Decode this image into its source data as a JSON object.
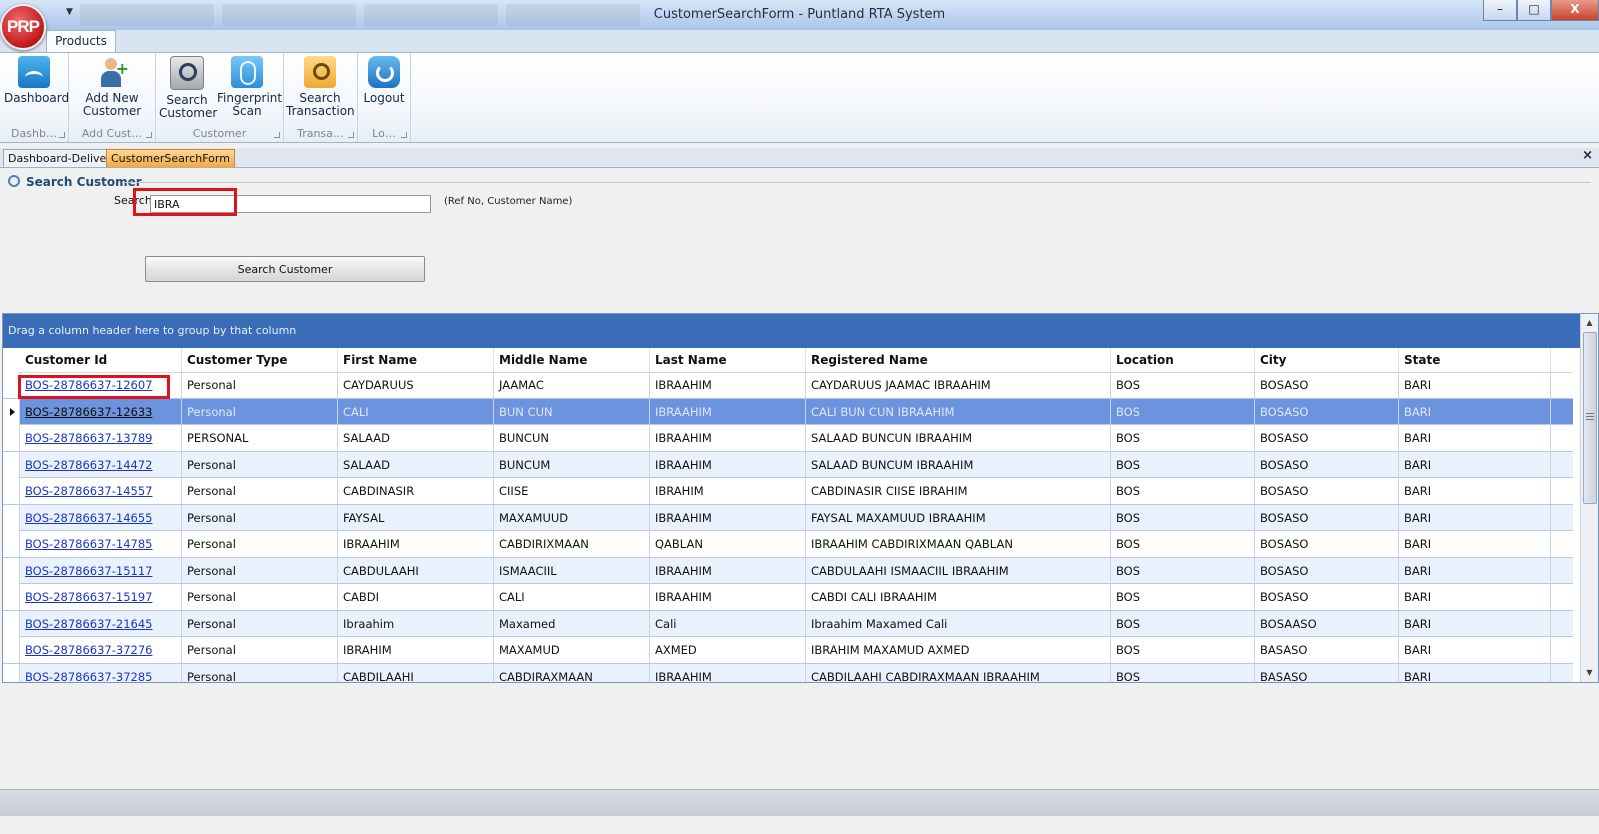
{
  "window": {
    "title": "CustomerSearchForm - Puntland RTA System",
    "logo": "PRP",
    "controls": {
      "minimize": "–",
      "maximize": "□",
      "close": "X"
    }
  },
  "ribbon": {
    "tab": "Products",
    "groups": [
      {
        "label": "Dashb…",
        "buttons": [
          {
            "label": "Dashboard",
            "icon": "dashboard-icon"
          }
        ]
      },
      {
        "label": "Add Cust…",
        "buttons": [
          {
            "label": "Add New Customer",
            "icon": "add-user-icon"
          }
        ]
      },
      {
        "label": "Customer",
        "buttons": [
          {
            "label": "Search Customer",
            "icon": "search-customer-icon"
          },
          {
            "label": "Fingerprint Scan",
            "icon": "fingerprint-icon"
          }
        ]
      },
      {
        "label": "Transa…",
        "buttons": [
          {
            "label": "Search Transaction",
            "icon": "search-transaction-icon"
          }
        ]
      },
      {
        "label": "Lo…",
        "buttons": [
          {
            "label": "Logout",
            "icon": "logout-icon"
          }
        ]
      }
    ]
  },
  "doc_tabs": [
    {
      "label": "Dashboard-Delivery",
      "active": false
    },
    {
      "label": "CustomerSearchForm",
      "active": true
    }
  ],
  "doc_close": "×",
  "search": {
    "section_title": "Search Customer",
    "label": "Search",
    "value": "IBRA",
    "hint": "(Ref No, Customer Name)",
    "button": "Search Customer"
  },
  "grid": {
    "group_panel_text": "Drag a column header here to group by that column",
    "columns": [
      "Customer Id",
      "Customer Type",
      "First Name",
      "Middle Name",
      "Last Name",
      "Registered Name",
      "Location",
      "City",
      "State"
    ],
    "rows": [
      [
        "BOS-28786637-12607",
        "Personal",
        "CAYDARUUS",
        "JAAMAC",
        "IBRAAHIM",
        "CAYDARUUS JAAMAC IBRAAHIM",
        "BOS",
        "BOSASO",
        "BARI"
      ],
      [
        "BOS-28786637-12633",
        "Personal",
        "CALI",
        "BUN CUN",
        "IBRAAHIM",
        "CALI BUN CUN IBRAAHIM",
        "BOS",
        "BOSASO",
        "BARI"
      ],
      [
        "BOS-28786637-13789",
        "PERSONAL",
        "SALAAD",
        "BUNCUN",
        "IBRAAHIM",
        "SALAAD BUNCUN IBRAAHIM",
        "BOS",
        "BOSASO",
        "BARI"
      ],
      [
        "BOS-28786637-14472",
        "Personal",
        "SALAAD",
        "BUNCUM",
        "IBRAAHIM",
        "SALAAD BUNCUM IBRAAHIM",
        "BOS",
        "BOSASO",
        "BARI"
      ],
      [
        "BOS-28786637-14557",
        "Personal",
        "CABDINASIR",
        "CIISE",
        "IBRAHIM",
        "CABDINASIR CIISE IBRAHIM",
        "BOS",
        "BOSASO",
        "BARI"
      ],
      [
        "BOS-28786637-14655",
        "Personal",
        "FAYSAL",
        "MAXAMUUD",
        "IBRAAHIM",
        "FAYSAL MAXAMUUD IBRAAHIM",
        "BOS",
        "BOSASO",
        "BARI"
      ],
      [
        "BOS-28786637-14785",
        "Personal",
        "IBRAAHIM",
        "CABDIRIXMAAN",
        "QABLAN",
        "IBRAAHIM  CABDIRIXMAAN QABLAN",
        "BOS",
        "BOSASO",
        "BARI"
      ],
      [
        "BOS-28786637-15117",
        "Personal",
        "CABDULAAHI",
        "ISMAACIIL",
        "IBRAAHIM",
        "CABDULAAHI ISMAACIIL IBRAAHIM",
        "BOS",
        "BOSASO",
        "BARI"
      ],
      [
        "BOS-28786637-15197",
        "Personal",
        "CABDI",
        "CALI",
        "IBRAAHIM",
        "CABDI  CALI  IBRAAHIM",
        "BOS",
        "BOSASO",
        "BARI"
      ],
      [
        "BOS-28786637-21645",
        "Personal",
        "Ibraahim",
        "Maxamed",
        "Cali",
        "Ibraahim Maxamed Cali",
        "BOS",
        "BOSAASO",
        "BARI"
      ],
      [
        "BOS-28786637-37276",
        "Personal",
        "IBRAHIM",
        "MAXAMUD",
        "AXMED",
        "IBRAHIM MAXAMUD AXMED",
        "BOS",
        "BASASO",
        "BARI"
      ],
      [
        "BOS-28786637-37285",
        "Personal",
        "CABDILAAHI",
        "CABDIRAXMAAN",
        "IBRAAHIM",
        "CABDILAAHI CABDIRAXMAAN IBRAAHIM",
        "BOS",
        "BASASO",
        "BARI"
      ]
    ],
    "selected_row": 1
  },
  "colors": {
    "group_panel": "#3a6cb8",
    "selected_row": "#6c93dd",
    "highlight_box": "#e0121b",
    "active_tab": "#f6a83b"
  }
}
